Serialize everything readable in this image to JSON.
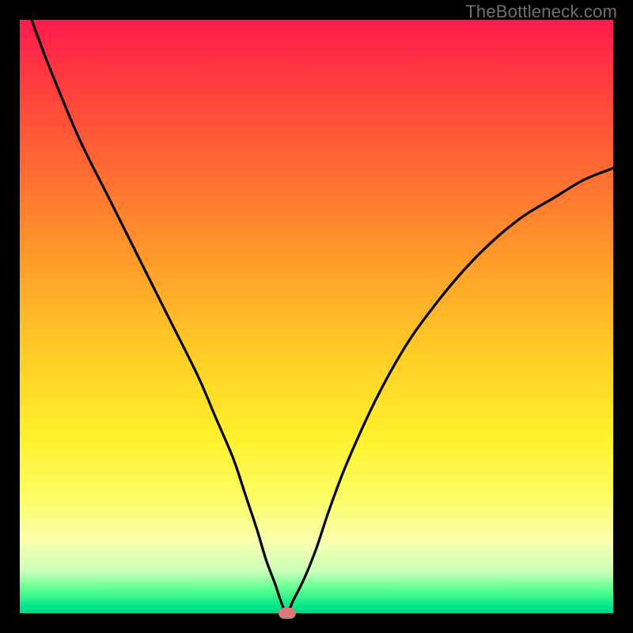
{
  "watermark": "TheBottleneck.com",
  "chart_data": {
    "type": "line",
    "title": "",
    "xlabel": "",
    "ylabel": "",
    "xlim": [
      0,
      100
    ],
    "ylim": [
      0,
      100
    ],
    "series": [
      {
        "name": "bottleneck-curve",
        "x": [
          2,
          5,
          10,
          15,
          20,
          25,
          30,
          33,
          36,
          38,
          40,
          41.5,
          43,
          44,
          45,
          46,
          48,
          50,
          52,
          55,
          60,
          65,
          70,
          75,
          80,
          85,
          90,
          95,
          100
        ],
        "y": [
          100,
          92,
          80,
          70,
          60,
          50,
          40,
          33,
          26,
          20,
          14,
          9,
          5,
          2,
          0,
          2,
          6,
          11,
          17,
          25,
          36,
          45,
          52,
          58,
          63,
          67,
          70,
          73,
          75
        ]
      }
    ],
    "marker": {
      "x": 45,
      "y": 0,
      "color": "#d97a7a"
    },
    "gradient_stops": [
      {
        "pos": 0,
        "color": "#ff1a4d"
      },
      {
        "pos": 10,
        "color": "#ff3b3f"
      },
      {
        "pos": 25,
        "color": "#ff6a33"
      },
      {
        "pos": 40,
        "color": "#ff9a2a"
      },
      {
        "pos": 55,
        "color": "#ffc928"
      },
      {
        "pos": 70,
        "color": "#fff02a"
      },
      {
        "pos": 80,
        "color": "#fdfd60"
      },
      {
        "pos": 88,
        "color": "#f8ffb0"
      },
      {
        "pos": 93,
        "color": "#c8ffb8"
      },
      {
        "pos": 96,
        "color": "#5cff8f"
      },
      {
        "pos": 99,
        "color": "#00e38a"
      },
      {
        "pos": 100,
        "color": "#00d185"
      }
    ]
  }
}
